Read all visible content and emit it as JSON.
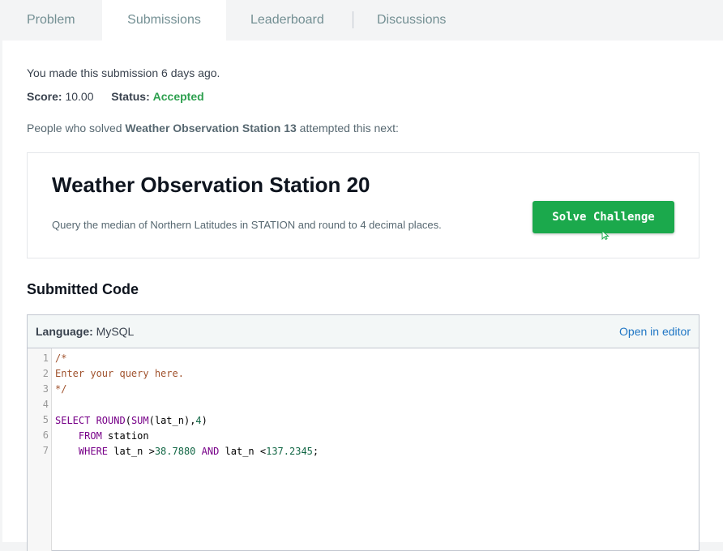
{
  "tabs": [
    {
      "label": "Problem"
    },
    {
      "label": "Submissions"
    },
    {
      "label": "Leaderboard"
    },
    {
      "label": "Discussions"
    }
  ],
  "submission": {
    "made_text": "You made this submission 6 days ago.",
    "score_label": "Score:",
    "score_value": "10.00",
    "status_label": "Status:",
    "status_value": "Accepted"
  },
  "next": {
    "prefix": "People who solved ",
    "solved_name": "Weather Observation Station 13",
    "suffix": " attempted this next:"
  },
  "challenge": {
    "title": "Weather Observation Station 20",
    "description": "Query the median of Northern Latitudes in STATION and round to 4 decimal places.",
    "button_label": "Solve Challenge"
  },
  "code_section": {
    "title": "Submitted Code",
    "language_label": "Language:",
    "language_value": "MySQL",
    "open_editor": "Open in editor",
    "line_numbers": [
      "1",
      "2",
      "3",
      "4",
      "5",
      "6",
      "7"
    ],
    "lines": {
      "l1": "/*",
      "l2": "Enter your query here.",
      "l3": "*/",
      "l5_kw1": "SELECT ROUND",
      "l5_p1": "(",
      "l5_kw2": "SUM",
      "l5_p2": "(lat_n),",
      "l5_num": "4",
      "l5_p3": ")",
      "l6_kw": "FROM",
      "l6_rest": " station",
      "l7_kw1": "WHERE",
      "l7_mid1": " lat_n >",
      "l7_num1": "38.7880",
      "l7_kw2": " AND",
      "l7_mid2": " lat_n <",
      "l7_num2": "137.2345",
      "l7_end": ";"
    }
  },
  "colors": {
    "accent_green": "#1ba94c",
    "status_green": "#2ea04f",
    "link_blue": "#1f76c5"
  }
}
